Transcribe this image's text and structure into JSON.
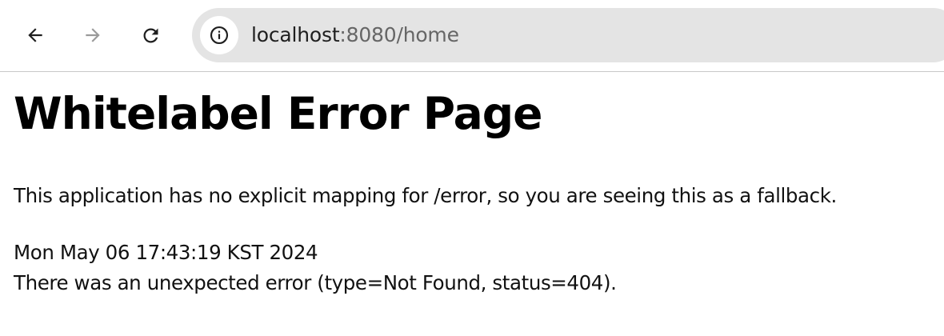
{
  "browser": {
    "url_host": "localhost",
    "url_rest": ":8080/home",
    "icons": {
      "back": "back-arrow-icon",
      "forward": "forward-arrow-icon",
      "reload": "reload-icon",
      "site_info": "info-circle-icon"
    }
  },
  "page": {
    "title": "Whitelabel Error Page",
    "message": "This application has no explicit mapping for /error, so you are seeing this as a fallback.",
    "timestamp": "Mon May 06 17:43:19 KST 2024",
    "error": "There was an unexpected error (type=Not Found, status=404)."
  },
  "colors": {
    "omnibox_bg": "#e4e4e4",
    "text": "#111111",
    "url_secondary": "#666666",
    "forward_disabled": "#9a9a9a"
  }
}
